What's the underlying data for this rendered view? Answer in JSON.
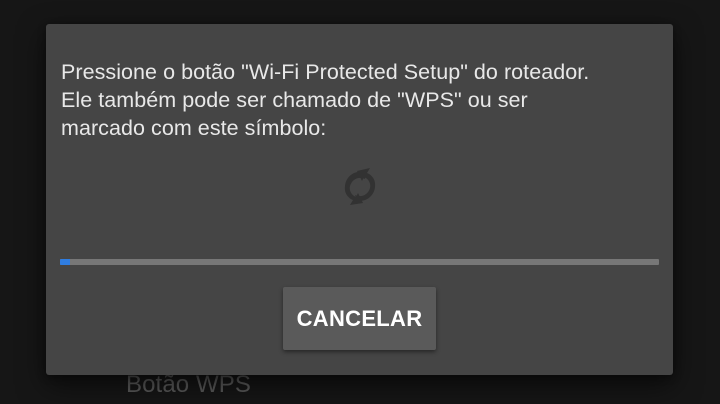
{
  "background": {
    "label": "Botão WPS"
  },
  "dialog": {
    "message": "Pressione o botão \"Wi-Fi Protected Setup\" do roteador.\nEle também pode ser chamado de \"WPS\" ou ser\nmarcado com este símbolo:",
    "symbol_icon": "wps-icon",
    "progress": 0.016,
    "cancel_label": "CANCELAR"
  },
  "colors": {
    "dialog_bg": "#454545",
    "progress_accent": "#2f7de1",
    "progress_track": "#777777"
  }
}
